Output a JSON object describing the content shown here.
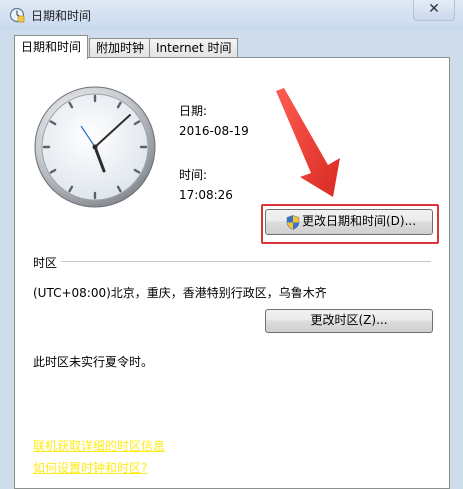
{
  "window": {
    "title": "日期和时间",
    "close_glyph": "✕"
  },
  "tabs": [
    {
      "label": "日期和时间",
      "active": true
    },
    {
      "label": "附加时钟",
      "active": false
    },
    {
      "label": "Internet 时间",
      "active": false
    }
  ],
  "datetime": {
    "date_label": "日期:",
    "date_value": "2016-08-19",
    "time_label": "时间:",
    "time_value": "17:08:26",
    "change_button": "更改日期和时间(D)..."
  },
  "timezone": {
    "section_label": "时区",
    "value": "(UTC+08:00)北京，重庆，香港特别行政区，乌鲁木齐",
    "change_button": "更改时区(Z)...",
    "dst_note": "此时区未实行夏令时。"
  },
  "links": [
    "联机获取详细的时区信息",
    "如何设置时钟和时区?"
  ],
  "colors": {
    "highlight": "#d9353a",
    "arrow": "#e8312f",
    "link": "#ffeb1a"
  },
  "icons": {
    "title": "clock-icon",
    "shield": "uac-shield-icon",
    "close": "close-icon"
  }
}
